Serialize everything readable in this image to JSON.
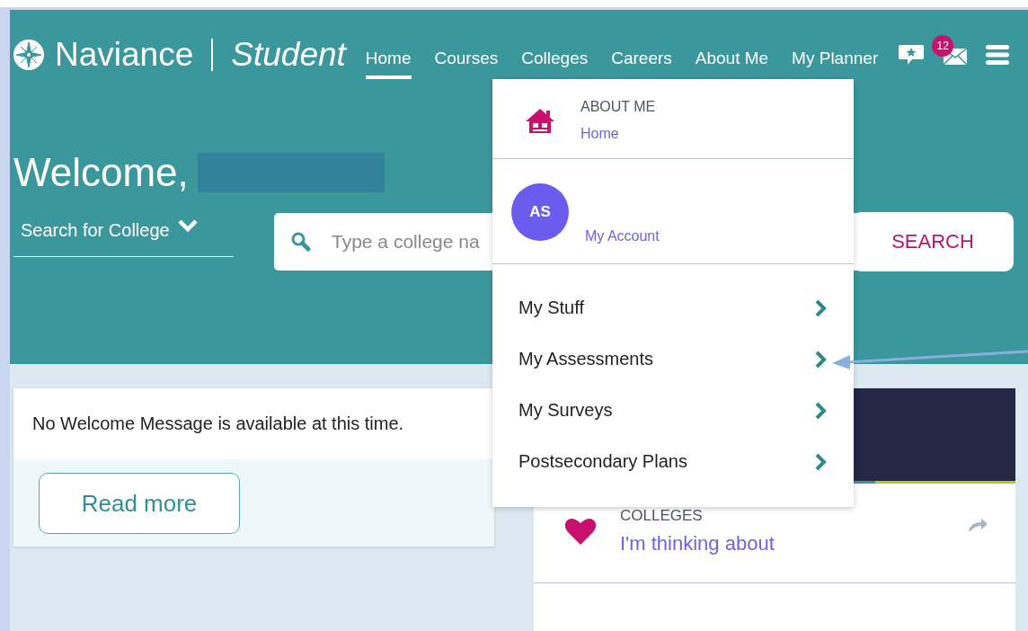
{
  "brand": {
    "name": "Naviance",
    "product": "Student"
  },
  "nav": [
    {
      "label": "Home",
      "selected": true
    },
    {
      "label": "Courses",
      "selected": false
    },
    {
      "label": "Colleges",
      "selected": false
    },
    {
      "label": "Careers",
      "selected": false
    },
    {
      "label": "About Me",
      "selected": false
    },
    {
      "label": "My Planner",
      "selected": false
    }
  ],
  "messages_badge": "12",
  "welcome": {
    "greeting": "Welcome,"
  },
  "search": {
    "scope": "Search for College",
    "placeholder": "Type a college na",
    "button": "SEARCH"
  },
  "welcome_card": {
    "message": "No Welcome Message is available at this time.",
    "button": "Read more"
  },
  "dropdown": {
    "category": "ABOUT ME",
    "category_link": "Home",
    "initials": "AS",
    "account_link": "My Account",
    "items": [
      {
        "label": "My Stuff"
      },
      {
        "label": "My Assessments"
      },
      {
        "label": "My Surveys"
      },
      {
        "label": "Postsecondary Plans"
      }
    ]
  },
  "colleges_card": {
    "category": "COLLEGES",
    "link": "I'm thinking about"
  }
}
